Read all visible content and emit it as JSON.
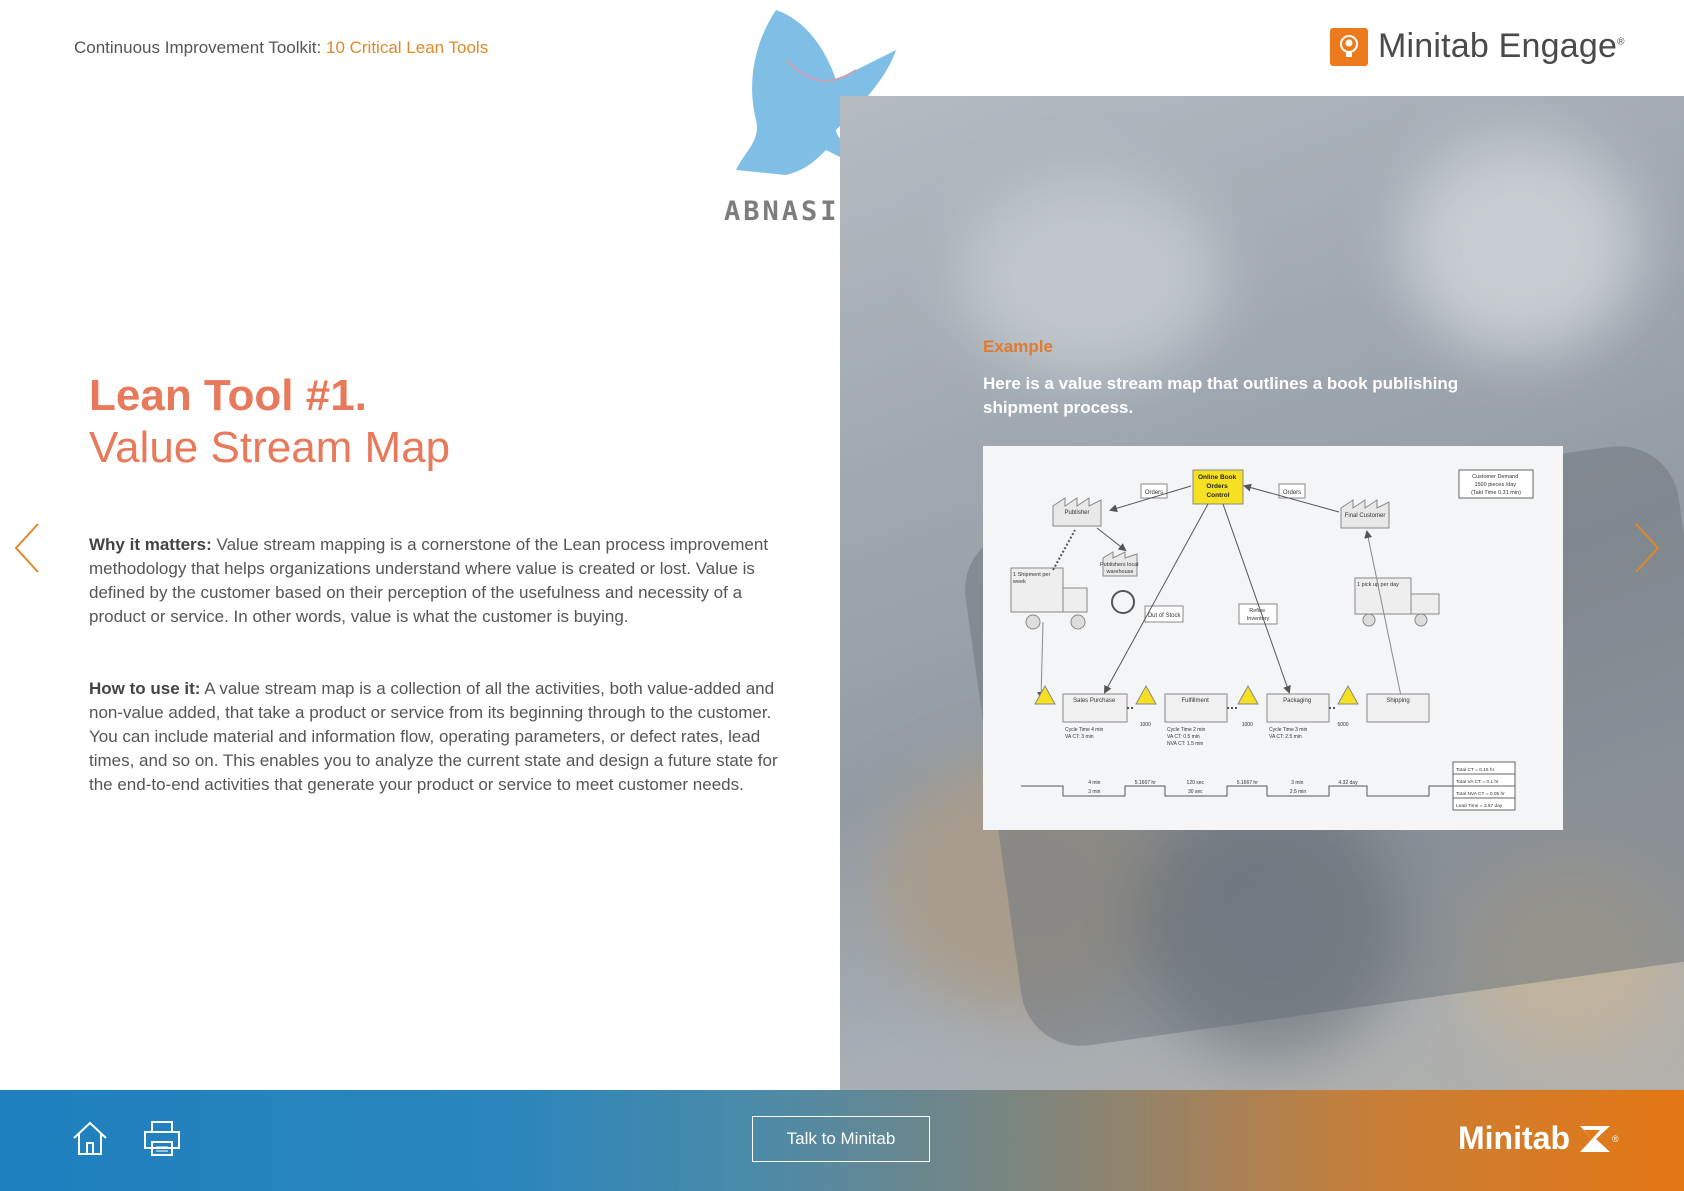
{
  "header": {
    "crumb_prefix": "Continuous Improvement Toolkit: ",
    "crumb_link": "10 Critical Lean Tools",
    "brand_name": "Minitab Engage",
    "brand_mark": "®"
  },
  "watermark": {
    "text": "ABNASIA.ORG"
  },
  "main": {
    "title_line1": "Lean Tool #1.",
    "title_line2": "Value Stream Map",
    "why_label": "Why it matters:",
    "why_text": " Value stream mapping is a cornerstone of the Lean process improvement methodology that helps organizations understand where value is created or lost. Value is defined by the customer based on their perception of the usefulness and necessity of a product or service. In other words, value is what the customer is buying.",
    "how_label": "How to use it:",
    "how_text": " A value stream map is a collection of all the activities, both value-added and non-value added, that take a product or service from its beginning through to the customer. You can include material and information flow, operating parameters, or defect rates, lead times, and so on. This enables you to analyze the current state and design a future state for the end-to-end activities that generate your product or service to meet customer needs."
  },
  "example": {
    "label": "Example",
    "description": "Here is a value stream map that outlines a book publishing shipment process.",
    "vsm": {
      "control_box": [
        "Online Book",
        "Orders",
        "Control"
      ],
      "customer_demand": [
        "Customer Demand",
        "1500 pieces /day",
        "(Takt Time 0.31 min)"
      ],
      "publisher": "Publisher",
      "final_customer": "Final Customer",
      "orders_left": "Orders",
      "orders_right": "Orders",
      "warehouse": [
        "Publishers local",
        "warehouse"
      ],
      "shipment": [
        "1 Shipment per",
        "week"
      ],
      "pickup": "1 pick up per day",
      "out_of_stock": "Out of Stock",
      "refine": [
        "Refine",
        "Inventory"
      ],
      "processes": [
        "Sales Purchase",
        "Fulfillment",
        "Packaging",
        "Shipping"
      ],
      "inventory_counts": [
        "1000",
        "1000",
        "5000"
      ],
      "proc1_data": [
        "Cycle Time   4 min",
        "VA CT:       3 min"
      ],
      "proc2_data": [
        "Cycle Time   2 min",
        "VA CT:       0.5 min",
        "NVA CT:      1.5 min"
      ],
      "proc3_data": [
        "Cycle Time   3 min",
        "VA CT:       2.5 min"
      ],
      "timeline_top": [
        "4 min",
        "5.1667 hr",
        "120 sec",
        "5.1667 hr",
        "3 min",
        "4.32 day"
      ],
      "timeline_bottom": [
        "3 min",
        "30 sec",
        "2.5 min"
      ],
      "totals": [
        "Total CT = 0.15 hr",
        "Total VA CT = 0.1 hr",
        "Total NVA CT = 0.05 hr",
        "Lead Time = 3.67 day"
      ]
    }
  },
  "footer": {
    "talk_label": "Talk to Minitab",
    "brand_name": "Minitab",
    "brand_mark": "®"
  },
  "colors": {
    "accent_orange": "#e8795a",
    "link_orange": "#e0892a",
    "footer_blue": "#1f7fbf",
    "footer_orange": "#e47815"
  }
}
